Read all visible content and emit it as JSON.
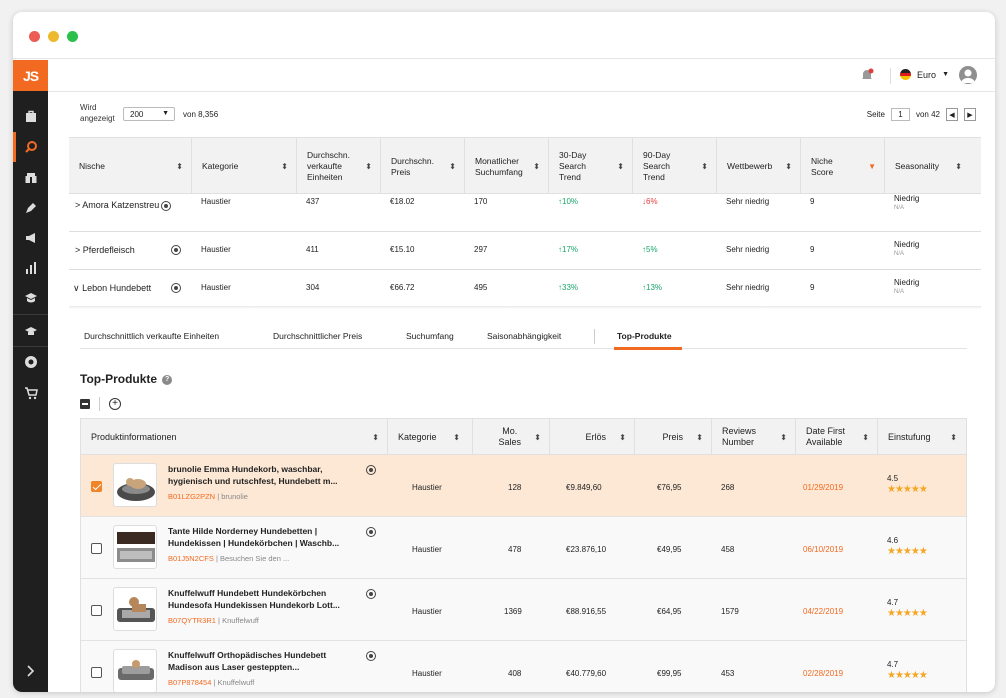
{
  "app": {
    "logo": "JS"
  },
  "topbar": {
    "currency": "Euro"
  },
  "list_controls": {
    "shown_label_line1": "Wird",
    "shown_label_line2": "angezeigt",
    "per_page": "200",
    "of_total": "von 8,356",
    "page_label": "Seite",
    "page_current": "1",
    "page_of": "von 42"
  },
  "niche_table": {
    "headers": [
      "Nische",
      "Kategorie",
      "Durchschn.",
      "verkaufte",
      "Einheiten",
      "Durchschn.",
      "Preis",
      "Monatlicher",
      "Suchumfang",
      "30-Day",
      "Search",
      "Trend",
      "90-Day",
      "Search",
      "Trend",
      "Wettbewerb",
      "Niche",
      "Score",
      "Seasonality"
    ],
    "rows": [
      {
        "expander": ">",
        "name": "Amora Katzenstreu",
        "category": "Haustier",
        "units": "437",
        "price": "€18.02",
        "search": "170",
        "trend30": "↑10%",
        "trend90": "↓6%",
        "competition": "Sehr niedrig",
        "score": "9",
        "seasonality": "Niedrig",
        "seasonality_sub": "N/A"
      },
      {
        "expander": ">",
        "name": "Pferdefleisch",
        "category": "Haustier",
        "units": "411",
        "price": "€15.10",
        "search": "297",
        "trend30": "↑17%",
        "trend90": "↑5%",
        "competition": "Sehr niedrig",
        "score": "9",
        "seasonality": "Niedrig",
        "seasonality_sub": "N/A"
      },
      {
        "expander": "∨",
        "name": "Lebon Hundebett",
        "category": "Haustier",
        "units": "304",
        "price": "€66.72",
        "search": "495",
        "trend30": "↑33%",
        "trend90": "↑13%",
        "competition": "Sehr niedrig",
        "score": "9",
        "seasonality": "Niedrig",
        "seasonality_sub": "N/A"
      }
    ]
  },
  "tabs": [
    "Durchschnittlich verkaufte Einheiten",
    "Durchschnittlicher Preis",
    "Suchumfang",
    "Saisonabhängigkeit",
    "Top-Produkte"
  ],
  "section": {
    "title": "Top-Produkte"
  },
  "product_table": {
    "headers": [
      "Produktinformationen",
      "Kategorie",
      "Mo.",
      "Sales",
      "Erlös",
      "Preis",
      "Reviews",
      "Number",
      "Date First",
      "Available",
      "Einstufung"
    ],
    "rows": [
      {
        "name": "brunolie Emma Hundekorb, waschbar, hygienisch und rutschfest, Hundebett m...",
        "asin": "B01LZG2PZN",
        "brand": "brunolie",
        "category": "Haustier",
        "sales": "128",
        "revenue": "€9.849,60",
        "price": "€76,95",
        "reviews": "268",
        "date": "01/29/2019",
        "rating": "4.5",
        "stars": "★★★★★",
        "checked": true
      },
      {
        "name": "Tante Hilde Norderney Hundebetten | Hundekissen | Hundekörbchen | Waschb...",
        "asin": "B01J5N2CFS",
        "brand": "Besuchen Sie den ...",
        "category": "Haustier",
        "sales": "478",
        "revenue": "€23.876,10",
        "price": "€49,95",
        "reviews": "458",
        "date": "06/10/2019",
        "rating": "4.6",
        "stars": "★★★★★",
        "checked": false
      },
      {
        "name": "Knuffelwuff Hundebett Hundekörbchen Hundesofa Hundekissen Hundekorb Lott...",
        "asin": "B07QYTR3R1",
        "brand": "Knuffelwuff",
        "category": "Haustier",
        "sales": "1369",
        "revenue": "€88.916,55",
        "price": "€64,95",
        "reviews": "1579",
        "date": "04/22/2019",
        "rating": "4.7",
        "stars": "★★★★★",
        "checked": false
      },
      {
        "name": "Knuffelwuff Orthopädisches Hundebett Madison aus Laser gesteppten...",
        "asin": "B07P878454",
        "brand": "Knuffelwuff",
        "category": "Haustier",
        "sales": "408",
        "revenue": "€40.779,60",
        "price": "€99,95",
        "reviews": "453",
        "date": "02/28/2019",
        "rating": "4.7",
        "stars": "★★★★★",
        "checked": false
      }
    ]
  },
  "colors": {
    "accent": "#f26a21",
    "sidebar": "#1f1f1f",
    "trend_up": "#1aa56a",
    "trend_down": "#e23d3d",
    "selected_row": "#fde8d5"
  }
}
